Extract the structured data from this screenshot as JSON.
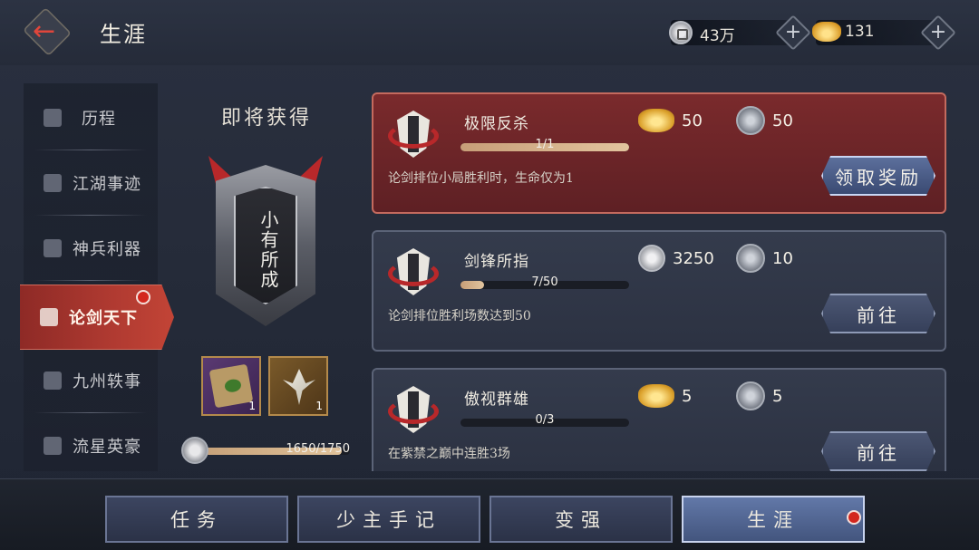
{
  "header": {
    "title": "生涯",
    "back_icon": "back-arrow-icon",
    "silver": {
      "icon": "silver-coin-icon",
      "value": "43万"
    },
    "gold": {
      "icon": "gold-ingot-icon",
      "value": "131"
    },
    "plus_symbol": "+"
  },
  "sidebar": {
    "items": [
      {
        "label": "历程",
        "icon": "shield-icon"
      },
      {
        "label": "江湖事迹",
        "icon": "book-icon"
      },
      {
        "label": "神兵利器",
        "icon": "crossed-swords-icon"
      },
      {
        "label": "论剑天下",
        "icon": "sparkle-icon",
        "active": true,
        "has_dot": true
      },
      {
        "label": "九州轶事",
        "icon": "mountain-icon"
      },
      {
        "label": "流星英豪",
        "icon": "hero-icon"
      }
    ]
  },
  "preview": {
    "title": "即将获得",
    "badge_text": "小有所成",
    "items": [
      {
        "icon": "scroll-icon",
        "count": "1"
      },
      {
        "icon": "dart-icon",
        "count": "1"
      }
    ],
    "progress_text": "1650/1750",
    "progress_fraction": 0.943
  },
  "tasks": [
    {
      "name": "极限反杀",
      "progress_text": "1/1",
      "progress_fraction": 1.0,
      "desc": "论剑排位小局胜利时，生命仅为1",
      "reward_a": {
        "icon": "gold-ingot-icon",
        "value": "50"
      },
      "reward_b": {
        "icon": "lotus-token-icon",
        "value": "50"
      },
      "button": "领取奖励",
      "state": "claimable"
    },
    {
      "name": "剑锋所指",
      "progress_text": "7/50",
      "progress_fraction": 0.14,
      "desc": "论剑排位胜利场数达到50",
      "reward_a": {
        "icon": "silver-coin-icon",
        "value": "3250"
      },
      "reward_b": {
        "icon": "lotus-token-icon",
        "value": "10"
      },
      "button": "前往",
      "state": "in-progress"
    },
    {
      "name": "傲视群雄",
      "progress_text": "0/3",
      "progress_fraction": 0.0,
      "desc": "在紫禁之巅中连胜3场",
      "reward_a": {
        "icon": "gold-ingot-icon",
        "value": "5"
      },
      "reward_b": {
        "icon": "lotus-token-icon",
        "value": "5"
      },
      "button": "前往",
      "state": "in-progress"
    }
  ],
  "bottom_tabs": [
    {
      "label": "任务"
    },
    {
      "label": "少主手记"
    },
    {
      "label": "变强"
    },
    {
      "label": "生涯",
      "active": true,
      "has_dot": true
    }
  ]
}
